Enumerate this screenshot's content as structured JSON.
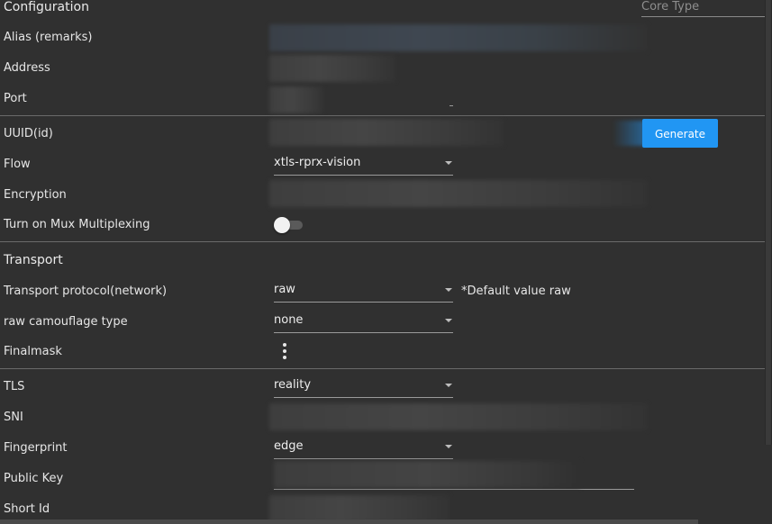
{
  "config": {
    "section_title": "Configuration",
    "core_type_placeholder": "Core Type",
    "alias_label": "Alias (remarks)",
    "address_label": "Address",
    "port_label": "Port"
  },
  "auth": {
    "uuid_label": "UUID(id)",
    "generate_button": "Generate",
    "flow_label": "Flow",
    "flow_value": "xtls-rprx-vision",
    "encryption_label": "Encryption",
    "mux_label": "Turn on Mux Multiplexing",
    "mux_enabled": false
  },
  "transport": {
    "section_title": "Transport",
    "protocol_label": "Transport protocol(network)",
    "protocol_value": "raw",
    "protocol_note": "*Default value raw",
    "camouflage_label": "raw camouflage type",
    "camouflage_value": "none",
    "finalmask_label": "Finalmask"
  },
  "tls": {
    "tls_label": "TLS",
    "tls_value": "reality",
    "sni_label": "SNI",
    "fingerprint_label": "Fingerprint",
    "fingerprint_value": "edge",
    "public_key_label": "Public Key",
    "short_id_label": "Short Id"
  },
  "colors": {
    "background": "#303030",
    "accent": "#2196f3",
    "divider": "#6a6a6a"
  }
}
